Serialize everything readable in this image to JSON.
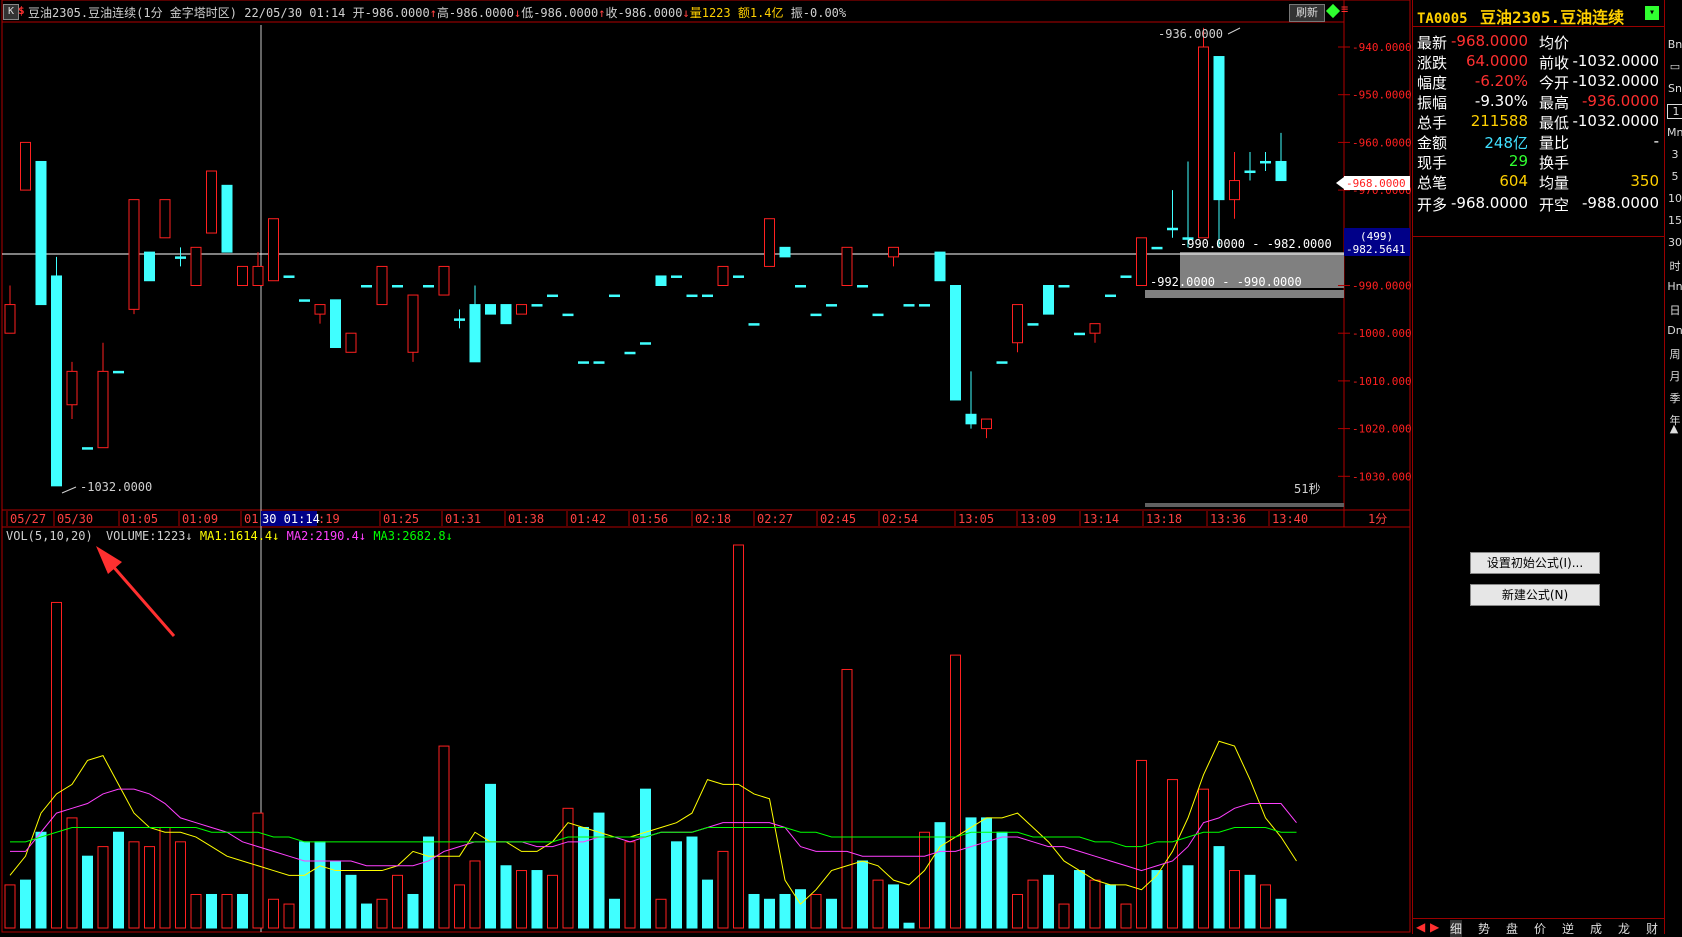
{
  "header": {
    "k_icon": "K",
    "dollar_icon": "$",
    "symbol_title": "豆油2305.豆油连续(1分 金字塔时区)",
    "date_time": "22/05/30 01:14",
    "open": "开-986.0000",
    "high": "高-986.0000",
    "low": "低-986.0000",
    "close": "收-986.0000",
    "volume": "量1223",
    "amount": "额1.4亿",
    "amplitude": "振-0.00%",
    "refresh_label": "刷新"
  },
  "price_axis": {
    "labels": [
      "-940.0000",
      "-950.0000",
      "-960.0000",
      "-970.0000",
      "-990.0000",
      "-1000.0000",
      "-1010.0000",
      "-1020.0000",
      "-1030.0000"
    ],
    "current_price_tag": "-968.0000",
    "crosshair_count": "(499)",
    "crosshair_price": "-982.5641"
  },
  "annotations": {
    "high_marker": "-936.0000",
    "low_marker": "-1032.0000",
    "zone1": "-990.0000 - -982.0000",
    "zone2": "-992.0000 - -990.0000",
    "countdown": "51秒"
  },
  "time_axis": {
    "labels": [
      "05/27",
      "05/30",
      "01:05",
      "01:09",
      "01",
      "30 01:14",
      ":19",
      "01:25",
      "01:31",
      "01:38",
      "01:42",
      "01:56",
      "02:18",
      "02:27",
      "02:45",
      "02:54",
      "13:05",
      "13:09",
      "13:14",
      "13:18",
      "13:36",
      "13:40"
    ],
    "period": "1分",
    "highlight": "30 01:14"
  },
  "indicator": {
    "name": "VOL(5,10,20)",
    "volume": "VOLUME:1223",
    "ma1": "MA1:1614.4",
    "ma2": "MA2:2190.4",
    "ma3": "MA3:2682.8",
    "arrow": "↓"
  },
  "side_panel": {
    "code": "TA0005",
    "name": "豆油2305.豆油连续",
    "quotes": [
      {
        "l1": "最新",
        "v1": "-968.0000",
        "c1": "#ff3030",
        "l2": "均价",
        "v2": "",
        "c2": "#ffffff"
      },
      {
        "l1": "涨跌",
        "v1": "64.0000",
        "c1": "#ff3030",
        "l2": "前收",
        "v2": "-1032.0000",
        "c2": "#ffffff"
      },
      {
        "l1": "幅度",
        "v1": "-6.20%",
        "c1": "#ff3030",
        "l2": "今开",
        "v2": "-1032.0000",
        "c2": "#ffffff"
      },
      {
        "l1": "振幅",
        "v1": "-9.30%",
        "c1": "#ffffff",
        "l2": "最高",
        "v2": "-936.0000",
        "c2": "#ff3030"
      },
      {
        "l1": "总手",
        "v1": "211588",
        "c1": "#ffd000",
        "l2": "最低",
        "v2": "-1032.0000",
        "c2": "#ffffff"
      },
      {
        "l1": "金额",
        "v1": "248亿",
        "c1": "#40e0ff",
        "l2": "量比",
        "v2": "-",
        "c2": "#ffffff"
      },
      {
        "l1": "现手",
        "v1": "29",
        "c1": "#30ff30",
        "l2": "换手",
        "v2": "",
        "c2": "#ffffff"
      },
      {
        "l1": "总笔",
        "v1": "604",
        "c1": "#ffd000",
        "l2": "均量",
        "v2": "350",
        "c2": "#ffd000"
      },
      {
        "l1": "开多",
        "v1": "-968.0000",
        "c1": "#ffffff",
        "l2": "开空",
        "v2": "-988.0000",
        "c2": "#ffffff"
      }
    ],
    "btn_formula": "设置初始公式(I)...",
    "btn_new": "新建公式(N)",
    "tabs": [
      "细",
      "势",
      "盘",
      "价",
      "逆",
      "成",
      "龙",
      "财"
    ]
  },
  "right_toolbar": [
    "Bn",
    "",
    "Sn",
    "1",
    "Mn",
    "3",
    "5",
    "10",
    "15",
    "30",
    "时",
    "Hn",
    "日",
    "Dn",
    "周",
    "月",
    "季",
    "年"
  ],
  "colors": {
    "up": "#ff2020",
    "down": "#40ffff",
    "ma1": "#ffff00",
    "ma2": "#ff40ff",
    "ma3": "#00ff00",
    "frame": "#b00000"
  },
  "chart_data": {
    "type": "candlestick",
    "price_range": [
      -1035,
      -932
    ],
    "candles": [
      {
        "o": -1000,
        "h": -990,
        "l": -1000,
        "c": -994
      },
      {
        "o": -970,
        "h": -960,
        "l": -970,
        "c": -960
      },
      {
        "o": -964,
        "h": -964,
        "l": -994,
        "c": -994
      },
      {
        "o": -988,
        "h": -984,
        "l": -1032,
        "c": -1032
      },
      {
        "o": -1015,
        "h": -1006,
        "l": -1018,
        "c": -1008
      },
      {
        "o": -1024,
        "h": -1024,
        "l": -1024,
        "c": -1024
      },
      {
        "o": -1024,
        "h": -1002,
        "l": -1024,
        "c": -1008
      },
      {
        "o": -1008,
        "h": -1008,
        "l": -1008,
        "c": -1008
      },
      {
        "o": -995,
        "h": -972,
        "l": -996,
        "c": -972
      },
      {
        "o": -983,
        "h": -983,
        "l": -989,
        "c": -989
      },
      {
        "o": -980,
        "h": -972,
        "l": -980,
        "c": -972
      },
      {
        "o": -984,
        "h": -982,
        "l": -986,
        "c": -984
      },
      {
        "o": -990,
        "h": -982,
        "l": -990,
        "c": -982
      },
      {
        "o": -979,
        "h": -966,
        "l": -979,
        "c": -966
      },
      {
        "o": -969,
        "h": -969,
        "l": -983,
        "c": -983
      },
      {
        "o": -990,
        "h": -986,
        "l": -990,
        "c": -986
      },
      {
        "o": -990,
        "h": -983,
        "l": -990,
        "c": -986
      },
      {
        "o": -989,
        "h": -976,
        "l": -989,
        "c": -976
      },
      {
        "o": -988,
        "h": -988,
        "l": -988,
        "c": -988
      },
      {
        "o": -993,
        "h": -993,
        "l": -993,
        "c": -993
      },
      {
        "o": -996,
        "h": -994,
        "l": -998,
        "c": -994
      },
      {
        "o": -993,
        "h": -993,
        "l": -1003,
        "c": -1003
      },
      {
        "o": -1004,
        "h": -1000,
        "l": -1004,
        "c": -1000
      },
      {
        "o": -990,
        "h": -990,
        "l": -990,
        "c": -990
      },
      {
        "o": -994,
        "h": -986,
        "l": -994,
        "c": -986
      },
      {
        "o": -990,
        "h": -990,
        "l": -990,
        "c": -990
      },
      {
        "o": -1004,
        "h": -992,
        "l": -1006,
        "c": -992
      },
      {
        "o": -990,
        "h": -990,
        "l": -990,
        "c": -990
      },
      {
        "o": -992,
        "h": -986,
        "l": -992,
        "c": -986
      },
      {
        "o": -997,
        "h": -995,
        "l": -999,
        "c": -997
      },
      {
        "o": -994,
        "h": -990,
        "l": -1006,
        "c": -1006
      },
      {
        "o": -994,
        "h": -994,
        "l": -996,
        "c": -996
      },
      {
        "o": -994,
        "h": -994,
        "l": -998,
        "c": -998
      },
      {
        "o": -996,
        "h": -994,
        "l": -996,
        "c": -994
      },
      {
        "o": -994,
        "h": -994,
        "l": -994,
        "c": -994
      },
      {
        "o": -992,
        "h": -992,
        "l": -992,
        "c": -992
      },
      {
        "o": -996,
        "h": -996,
        "l": -996,
        "c": -996
      },
      {
        "o": -1006,
        "h": -1006,
        "l": -1006,
        "c": -1006
      },
      {
        "o": -1006,
        "h": -1006,
        "l": -1006,
        "c": -1006
      },
      {
        "o": -992,
        "h": -992,
        "l": -992,
        "c": -992
      },
      {
        "o": -1004,
        "h": -1004,
        "l": -1004,
        "c": -1004
      },
      {
        "o": -1002,
        "h": -1002,
        "l": -1002,
        "c": -1002
      },
      {
        "o": -988,
        "h": -988,
        "l": -990,
        "c": -990
      },
      {
        "o": -988,
        "h": -988,
        "l": -988,
        "c": -988
      },
      {
        "o": -992,
        "h": -992,
        "l": -992,
        "c": -992
      },
      {
        "o": -992,
        "h": -992,
        "l": -992,
        "c": -992
      },
      {
        "o": -990,
        "h": -986,
        "l": -990,
        "c": -986
      },
      {
        "o": -988,
        "h": -988,
        "l": -988,
        "c": -988
      },
      {
        "o": -998,
        "h": -998,
        "l": -998,
        "c": -998
      },
      {
        "o": -986,
        "h": -976,
        "l": -986,
        "c": -976
      },
      {
        "o": -982,
        "h": -982,
        "l": -984,
        "c": -984
      },
      {
        "o": -990,
        "h": -990,
        "l": -990,
        "c": -990
      },
      {
        "o": -996,
        "h": -996,
        "l": -996,
        "c": -996
      },
      {
        "o": -994,
        "h": -994,
        "l": -994,
        "c": -994
      },
      {
        "o": -990,
        "h": -982,
        "l": -990,
        "c": -982
      },
      {
        "o": -990,
        "h": -990,
        "l": -990,
        "c": -990
      },
      {
        "o": -996,
        "h": -996,
        "l": -996,
        "c": -996
      },
      {
        "o": -984,
        "h": -982,
        "l": -986,
        "c": -982
      },
      {
        "o": -994,
        "h": -994,
        "l": -994,
        "c": -994
      },
      {
        "o": -994,
        "h": -994,
        "l": -994,
        "c": -994
      },
      {
        "o": -983,
        "h": -983,
        "l": -989,
        "c": -989
      },
      {
        "o": -990,
        "h": -990,
        "l": -1014,
        "c": -1014
      },
      {
        "o": -1017,
        "h": -1008,
        "l": -1020,
        "c": -1019
      },
      {
        "o": -1020,
        "h": -1018,
        "l": -1022,
        "c": -1018
      },
      {
        "o": -1006,
        "h": -1006,
        "l": -1006,
        "c": -1006
      },
      {
        "o": -1002,
        "h": -994,
        "l": -1004,
        "c": -994
      },
      {
        "o": -998,
        "h": -998,
        "l": -998,
        "c": -998
      },
      {
        "o": -990,
        "h": -990,
        "l": -996,
        "c": -996
      },
      {
        "o": -990,
        "h": -990,
        "l": -990,
        "c": -990
      },
      {
        "o": -1000,
        "h": -1000,
        "l": -1000,
        "c": -1000
      },
      {
        "o": -1000,
        "h": -998,
        "l": -1002,
        "c": -998
      },
      {
        "o": -992,
        "h": -992,
        "l": -992,
        "c": -992
      },
      {
        "o": -988,
        "h": -988,
        "l": -988,
        "c": -988
      },
      {
        "o": -990,
        "h": -980,
        "l": -990,
        "c": -980
      },
      {
        "o": -982,
        "h": -982,
        "l": -982,
        "c": -982
      },
      {
        "o": -978,
        "h": -970,
        "l": -980,
        "c": -978
      },
      {
        "o": -980,
        "h": -964,
        "l": -982,
        "c": -980
      },
      {
        "o": -980,
        "h": -936,
        "l": -980,
        "c": -940
      },
      {
        "o": -942,
        "h": -942,
        "l": -982,
        "c": -972
      },
      {
        "o": -972,
        "h": -962,
        "l": -976,
        "c": -968
      },
      {
        "o": -966,
        "h": -962,
        "l": -968,
        "c": -966
      },
      {
        "o": -964,
        "h": -962,
        "l": -966,
        "c": -964
      },
      {
        "o": -964,
        "h": -958,
        "l": -968,
        "c": -968
      }
    ],
    "volume_max": 8000,
    "volumes": [
      {
        "v": 900,
        "up": true
      },
      {
        "v": 1000,
        "up": false
      },
      {
        "v": 2000,
        "up": false
      },
      {
        "v": 6800,
        "up": true
      },
      {
        "v": 2300,
        "up": true
      },
      {
        "v": 1500,
        "up": false
      },
      {
        "v": 1700,
        "up": true
      },
      {
        "v": 2000,
        "up": false
      },
      {
        "v": 1800,
        "up": true
      },
      {
        "v": 1700,
        "up": true
      },
      {
        "v": 2100,
        "up": true
      },
      {
        "v": 1800,
        "up": true
      },
      {
        "v": 700,
        "up": true
      },
      {
        "v": 700,
        "up": false
      },
      {
        "v": 700,
        "up": true
      },
      {
        "v": 700,
        "up": false
      },
      {
        "v": 2400,
        "up": true
      },
      {
        "v": 600,
        "up": true
      },
      {
        "v": 500,
        "up": true
      },
      {
        "v": 1800,
        "up": false
      },
      {
        "v": 1800,
        "up": false
      },
      {
        "v": 1400,
        "up": false
      },
      {
        "v": 1100,
        "up": false
      },
      {
        "v": 500,
        "up": false
      },
      {
        "v": 600,
        "up": true
      },
      {
        "v": 1100,
        "up": true
      },
      {
        "v": 700,
        "up": false
      },
      {
        "v": 1900,
        "up": false
      },
      {
        "v": 3800,
        "up": true
      },
      {
        "v": 900,
        "up": true
      },
      {
        "v": 1400,
        "up": true
      },
      {
        "v": 3000,
        "up": false
      },
      {
        "v": 1300,
        "up": false
      },
      {
        "v": 1200,
        "up": true
      },
      {
        "v": 1200,
        "up": false
      },
      {
        "v": 1100,
        "up": true
      },
      {
        "v": 2500,
        "up": true
      },
      {
        "v": 2100,
        "up": false
      },
      {
        "v": 2400,
        "up": false
      },
      {
        "v": 600,
        "up": false
      },
      {
        "v": 1800,
        "up": true
      },
      {
        "v": 2900,
        "up": false
      },
      {
        "v": 600,
        "up": true
      },
      {
        "v": 1800,
        "up": false
      },
      {
        "v": 1900,
        "up": false
      },
      {
        "v": 1000,
        "up": false
      },
      {
        "v": 1600,
        "up": true
      },
      {
        "v": 8000,
        "up": true
      },
      {
        "v": 700,
        "up": false
      },
      {
        "v": 600,
        "up": false
      },
      {
        "v": 700,
        "up": false
      },
      {
        "v": 800,
        "up": false
      },
      {
        "v": 700,
        "up": true
      },
      {
        "v": 600,
        "up": false
      },
      {
        "v": 5400,
        "up": true
      },
      {
        "v": 1400,
        "up": false
      },
      {
        "v": 1000,
        "up": true
      },
      {
        "v": 900,
        "up": false
      },
      {
        "v": 100,
        "up": false
      },
      {
        "v": 2000,
        "up": true
      },
      {
        "v": 2200,
        "up": false
      },
      {
        "v": 5700,
        "up": true
      },
      {
        "v": 2300,
        "up": false
      },
      {
        "v": 2300,
        "up": false
      },
      {
        "v": 2000,
        "up": false
      },
      {
        "v": 700,
        "up": true
      },
      {
        "v": 1000,
        "up": true
      },
      {
        "v": 1100,
        "up": false
      },
      {
        "v": 500,
        "up": true
      },
      {
        "v": 1200,
        "up": false
      },
      {
        "v": 1000,
        "up": true
      },
      {
        "v": 900,
        "up": false
      },
      {
        "v": 500,
        "up": true
      },
      {
        "v": 3500,
        "up": true
      },
      {
        "v": 1200,
        "up": false
      },
      {
        "v": 3100,
        "up": true
      },
      {
        "v": 1300,
        "up": false
      },
      {
        "v": 2900,
        "up": true
      },
      {
        "v": 1700,
        "up": false
      },
      {
        "v": 1200,
        "up": true
      },
      {
        "v": 1100,
        "up": false
      },
      {
        "v": 900,
        "up": true
      },
      {
        "v": 600,
        "up": false
      }
    ],
    "ma1": [
      1100,
      1500,
      2400,
      2800,
      3000,
      3500,
      3600,
      3000,
      2400,
      2100,
      2000,
      2000,
      1900,
      1700,
      1500,
      1400,
      1300,
      1200,
      1100,
      1100,
      1300,
      1200,
      1200,
      1200,
      1200,
      1300,
      1600,
      1500,
      1500,
      1500,
      2000,
      1800,
      1800,
      1600,
      1600,
      1800,
      2200,
      2100,
      2000,
      1900,
      1900,
      2000,
      2100,
      2200,
      2400,
      3100,
      3000,
      3000,
      2800,
      2700,
      1000,
      500,
      800,
      1200,
      1300,
      1400,
      1300,
      1000,
      900,
      1200,
      1700,
      1900,
      2100,
      2300,
      2300,
      2400,
      2100,
      1800,
      1400,
      1200,
      1000,
      900,
      900,
      800,
      1100,
      1600,
      2300,
      3200,
      3900,
      3800,
      3100,
      2300,
      1900,
      1400
    ],
    "ma2": [
      1600,
      1600,
      2000,
      2400,
      2500,
      2600,
      2800,
      2900,
      2900,
      2800,
      2600,
      2300,
      2200,
      2100,
      2000,
      1800,
      1700,
      1600,
      1500,
      1400,
      1400,
      1400,
      1400,
      1300,
      1300,
      1300,
      1300,
      1400,
      1600,
      1700,
      1800,
      1800,
      1800,
      1800,
      1700,
      1700,
      1800,
      1800,
      1900,
      1900,
      1800,
      1900,
      2000,
      2000,
      2000,
      2100,
      2200,
      2200,
      2200,
      2200,
      2100,
      1700,
      1600,
      1600,
      1600,
      1500,
      1500,
      1500,
      1500,
      1500,
      1600,
      1600,
      1700,
      1800,
      1900,
      1900,
      1800,
      1700,
      1700,
      1600,
      1500,
      1400,
      1300,
      1200,
      1300,
      1400,
      1700,
      2200,
      2300,
      2500,
      2600,
      2600,
      2600,
      2200
    ],
    "ma3": [
      1800,
      1800,
      1900,
      2000,
      2100,
      2100,
      2100,
      2100,
      2100,
      2100,
      2100,
      2100,
      2100,
      2000,
      2000,
      2000,
      2000,
      1900,
      1900,
      1800,
      1800,
      1800,
      1800,
      1800,
      1800,
      1800,
      1800,
      1800,
      1800,
      1800,
      1800,
      1800,
      1800,
      1800,
      1800,
      1800,
      1900,
      1900,
      1900,
      1900,
      1900,
      1900,
      2000,
      2000,
      2000,
      2100,
      2100,
      2100,
      2100,
      2100,
      2100,
      2000,
      2000,
      1900,
      1900,
      1900,
      1900,
      1900,
      1900,
      1900,
      1900,
      1900,
      2000,
      2000,
      2000,
      2000,
      1900,
      1900,
      1900,
      1900,
      1800,
      1800,
      1700,
      1700,
      1800,
      1800,
      1900,
      2000,
      2000,
      2100,
      2100,
      2100,
      2000,
      2000
    ]
  }
}
